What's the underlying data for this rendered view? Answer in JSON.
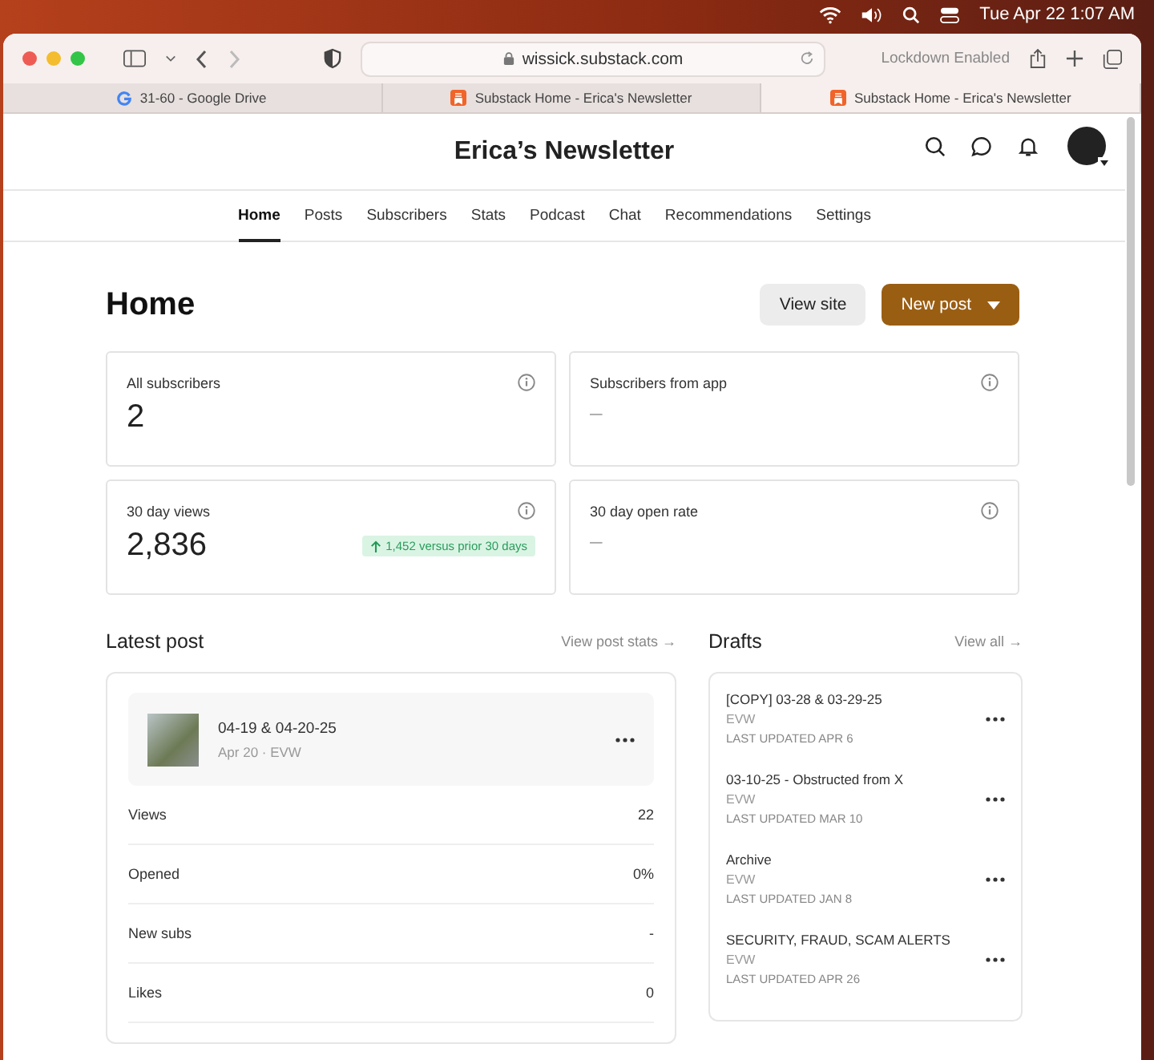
{
  "menu_bar": {
    "clock": "Tue Apr 22  1:07 AM"
  },
  "browser": {
    "address": "wissick.substack.com",
    "lockdown": "Lockdown Enabled",
    "tabs": [
      {
        "label": "31-60 - Google Drive",
        "kind": "drive",
        "selected": false
      },
      {
        "label": "Substack Home - Erica's Newsletter",
        "kind": "substack",
        "selected": false
      },
      {
        "label": "Substack Home - Erica's Newsletter",
        "kind": "substack",
        "selected": true
      }
    ]
  },
  "site_title": "Erica’s Newsletter",
  "nav": [
    {
      "label": "Home",
      "selected": true
    },
    {
      "label": "Posts",
      "selected": false
    },
    {
      "label": "Subscribers",
      "selected": false
    },
    {
      "label": "Stats",
      "selected": false
    },
    {
      "label": "Podcast",
      "selected": false
    },
    {
      "label": "Chat",
      "selected": false
    },
    {
      "label": "Recommendations",
      "selected": false
    },
    {
      "label": "Settings",
      "selected": false
    }
  ],
  "page_title": "Home",
  "buttons": {
    "view_site": "View site",
    "new_post": "New post"
  },
  "stats": [
    {
      "label": "All subscribers",
      "value": "2",
      "empty": false
    },
    {
      "label": "Subscribers from app",
      "value": "–",
      "empty": true
    },
    {
      "label": "30 day views",
      "value": "2,836",
      "empty": false,
      "change": "1,452 versus prior 30 days"
    },
    {
      "label": "30 day open rate",
      "value": "–",
      "empty": true
    }
  ],
  "latest_post": {
    "heading": "Latest post",
    "link": "View post stats →",
    "title": "04-19 & 04-20-25",
    "meta": "Apr 20 · EVW",
    "metrics": [
      {
        "label": "Views",
        "value": "22"
      },
      {
        "label": "Opened",
        "value": "0%"
      },
      {
        "label": "New subs",
        "value": "-"
      },
      {
        "label": "Likes",
        "value": "0"
      }
    ]
  },
  "drafts": {
    "heading": "Drafts",
    "link": "View all →",
    "items": [
      {
        "title": "[COPY] 03-28 & 03-29-25",
        "author": "EVW",
        "updated": "LAST UPDATED APR 6"
      },
      {
        "title": "03-10-25 - Obstructed from X",
        "author": "EVW",
        "updated": "LAST UPDATED MAR 10"
      },
      {
        "title": "Archive",
        "author": "EVW",
        "updated": "LAST UPDATED JAN 8"
      },
      {
        "title": "SECURITY, FRAUD, SCAM ALERTS",
        "author": "EVW",
        "updated": "LAST UPDATED APR 26"
      }
    ]
  }
}
